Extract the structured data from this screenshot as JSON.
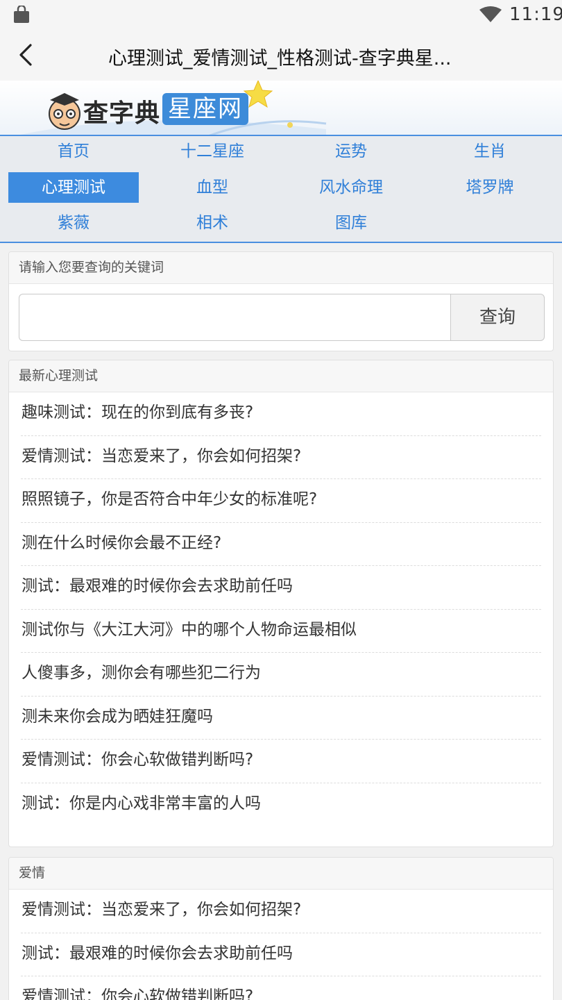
{
  "status_bar": {
    "time": "11:19",
    "icons": [
      "shopping-bag-icon",
      "wifi-icon"
    ]
  },
  "app_bar": {
    "back_icon": "arrow-left-icon",
    "title": "心理测试_爱情测试_性格测试-查字典星..."
  },
  "banner": {
    "logo_text": "查字典",
    "logo_box": "星座网"
  },
  "colors": {
    "accent": "#3d8bdf",
    "nav_text": "#2f7fd8"
  },
  "nav": {
    "items": [
      {
        "label": "首页"
      },
      {
        "label": "十二星座"
      },
      {
        "label": "运势"
      },
      {
        "label": "生肖"
      },
      {
        "label": "心理测试",
        "active": true
      },
      {
        "label": "血型"
      },
      {
        "label": "风水命理"
      },
      {
        "label": "塔罗牌"
      },
      {
        "label": "紫薇"
      },
      {
        "label": "相术"
      },
      {
        "label": "图库"
      }
    ]
  },
  "search": {
    "header": "请输入您要查询的关键词",
    "value": "",
    "button_label": "查询"
  },
  "latest": {
    "header": "最新心理测试",
    "items": [
      "趣味测试：现在的你到底有多丧?",
      "爱情测试：当恋爱来了，你会如何招架?",
      "照照镜子，你是否符合中年少女的标准呢?",
      "测在什么时候你会最不正经?",
      "测试：最艰难的时候你会去求助前任吗",
      "测试你与《大江大河》中的哪个人物命运最相似",
      "人傻事多，测你会有哪些犯二行为",
      "测未来你会成为晒娃狂魔吗",
      "爱情测试：你会心软做错判断吗?",
      "测试：你是内心戏非常丰富的人吗"
    ]
  },
  "love": {
    "header": "爱情",
    "items": [
      "爱情测试：当恋爱来了，你会如何招架?",
      "测试：最艰难的时候你会去求助前任吗",
      "爱情测试：你会心软做错判断吗?"
    ]
  }
}
